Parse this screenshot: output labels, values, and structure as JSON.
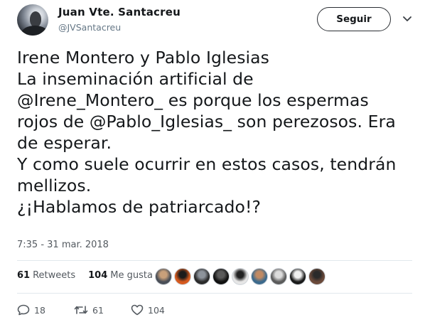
{
  "author": {
    "name": "Juan Vte. Santacreu",
    "handle": "@JVSantacreu"
  },
  "follow_label": "Seguir",
  "tweet": {
    "lines": [
      "Irene Montero y Pablo Iglesias",
      "La inseminación artificial de",
      "@Irene_Montero_  es porque los espermas",
      "rojos de  @Pablo_Iglesias_  son perezosos. Era",
      "de esperar.",
      "Y como suele ocurrir en estos casos, tendrán",
      "mellizos.",
      "¿¡Hablamos de patriarcado!?"
    ]
  },
  "timestamp": "7:35 - 31 mar. 2018",
  "stats": {
    "retweets_count": "61",
    "retweets_label": "Retweets",
    "likes_count": "104",
    "likes_label": "Me gusta"
  },
  "liker_avatars": [
    {
      "color_a": "#4a4f57",
      "color_b": "#c9a07a"
    },
    {
      "color_a": "#d65a1e",
      "color_b": "#1b1b1b"
    },
    {
      "color_a": "#2b2b2b",
      "color_b": "#8d939b"
    },
    {
      "color_a": "#111111",
      "color_b": "#5a5a5a"
    },
    {
      "color_a": "#e6e6e6",
      "color_b": "#222222"
    },
    {
      "color_a": "#3c6a8c",
      "color_b": "#c08a63"
    },
    {
      "color_a": "#5b5b5b",
      "color_b": "#dcdcdc"
    },
    {
      "color_a": "#1a1a1a",
      "color_b": "#f0f0f0"
    },
    {
      "color_a": "#6b4a3a",
      "color_b": "#2a2a2a"
    }
  ],
  "actions": {
    "replies": "18",
    "retweets": "61",
    "likes": "104"
  },
  "icons": {
    "caret": "chevron-down-icon",
    "reply": "reply-icon",
    "retweet": "retweet-icon",
    "like": "heart-icon"
  }
}
